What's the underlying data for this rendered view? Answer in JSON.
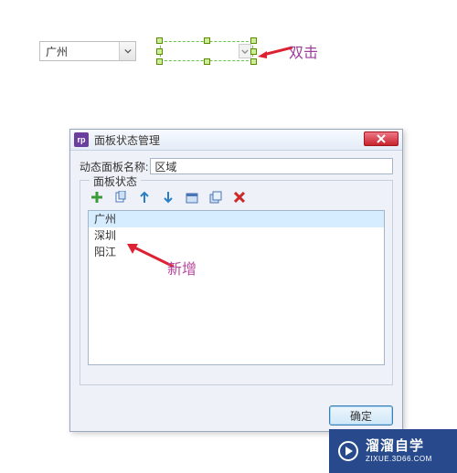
{
  "top_dropdown": {
    "value": "广州"
  },
  "annotations": {
    "doubleclick": "双击",
    "addnew": "新增"
  },
  "dialog": {
    "title": "面板状态管理",
    "name_label": "动态面板名称:",
    "name_value": "区域",
    "group_legend": "面板状态",
    "toolbar": {
      "add": "add-icon",
      "copy": "copy-icon",
      "up": "arrow-up-icon",
      "down": "arrow-down-icon",
      "edit": "edit-icon",
      "dup": "duplicate-icon",
      "delete": "delete-icon"
    },
    "states": [
      "广州",
      "深圳",
      "阳江"
    ],
    "ok": "确定",
    "cancel": ""
  },
  "watermark": {
    "title": "溜溜自学",
    "sub": "ZIXUE.3D66.COM"
  }
}
